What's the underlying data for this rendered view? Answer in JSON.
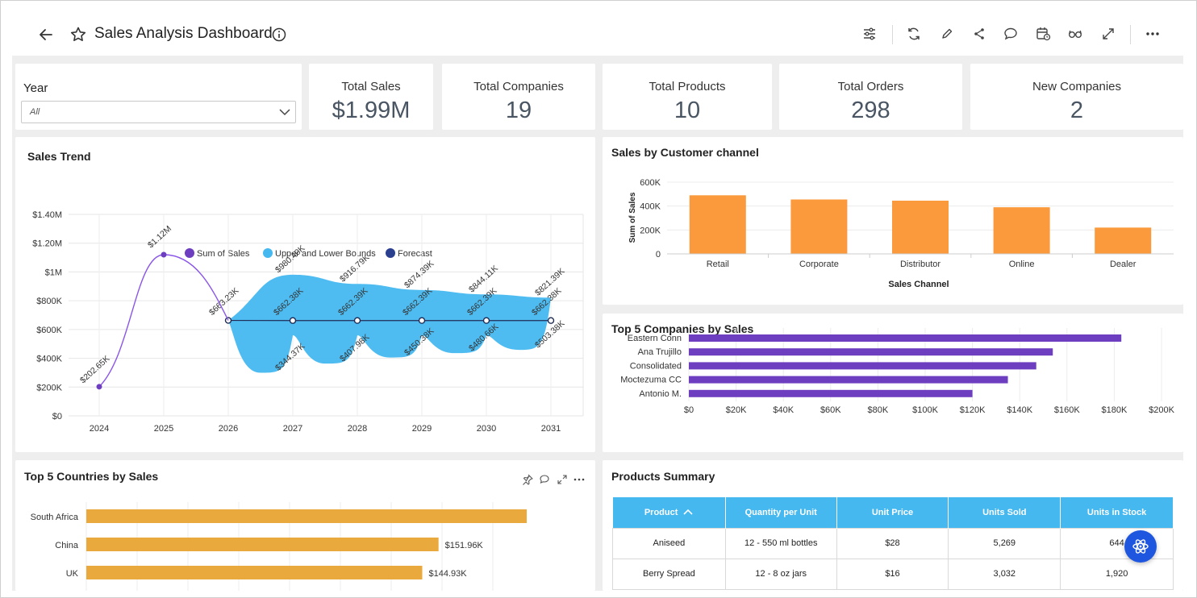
{
  "header": {
    "title": "Sales Analysis Dashboard",
    "toolbar_icons": [
      "filter-sliders-icon",
      "refresh-icon",
      "edit-pencil-icon",
      "share-icon",
      "comment-icon",
      "calendar-clock-icon",
      "glasses-icon",
      "expand-icon",
      "more-icon"
    ]
  },
  "filter": {
    "label": "Year",
    "value": "All"
  },
  "kpis": [
    {
      "title": "Total Sales",
      "value": "$1.99M"
    },
    {
      "title": "Total Companies",
      "value": "19"
    },
    {
      "title": "Total Products",
      "value": "10"
    },
    {
      "title": "Total Orders",
      "value": "298"
    },
    {
      "title": "New Companies",
      "value": "2"
    }
  ],
  "colors": {
    "accent": "#45b8f0",
    "orange": "#fb9a3d",
    "purple": "#6d3fc0",
    "gold": "#e9a93d",
    "fab": "#1e56e0"
  },
  "charts": {
    "sales_trend": {
      "title": "Sales Trend"
    },
    "channel": {
      "title": "Sales by Customer channel"
    },
    "companies": {
      "title": "Top 5 Companies by Sales"
    },
    "countries": {
      "title": "Top 5 Countries by Sales"
    },
    "products": {
      "title": "Products Summary"
    }
  },
  "chart_data": [
    {
      "type": "line",
      "title": "Sales Trend",
      "legend": [
        "Sum of Sales",
        "Upper and Lower Bounds",
        "Forecast"
      ],
      "legend_placement": "top-center",
      "x": [
        "2024",
        "2025",
        "2026",
        "2027",
        "2028",
        "2029",
        "2030",
        "2031"
      ],
      "y_ticks": [
        "$0",
        "$200K",
        "$400K",
        "$600K",
        "$800K",
        "$1M",
        "$1.20M",
        "$1.40M"
      ],
      "ylim": [
        0,
        1400000
      ],
      "grid": true,
      "series": [
        {
          "name": "Sum of Sales",
          "x": [
            "2024",
            "2025",
            "2026"
          ],
          "values": [
            202650,
            1120000,
            663230
          ],
          "labels": [
            "$202.65K",
            "$1.12M",
            "$663.23K"
          ]
        },
        {
          "name": "Forecast",
          "x": [
            "2026",
            "2027",
            "2028",
            "2029",
            "2030",
            "2031"
          ],
          "values": [
            663230,
            662380,
            662390,
            662390,
            662390,
            662380
          ],
          "labels": [
            "$663.23K",
            "$662.38K",
            "$662.39K",
            "$662.39K",
            "$662.39K",
            "$662.38K"
          ]
        },
        {
          "name": "Upper Bound",
          "x": [
            "2026",
            "2027",
            "2028",
            "2029",
            "2030",
            "2031"
          ],
          "values": [
            663230,
            980400,
            916790,
            874390,
            844110,
            821390
          ],
          "labels": [
            "",
            "$980.40K",
            "$916.79K",
            "$874.39K",
            "$844.11K",
            "$821.39K"
          ]
        },
        {
          "name": "Lower Bound",
          "x": [
            "2026",
            "2027",
            "2028",
            "2029",
            "2030",
            "2031"
          ],
          "values": [
            663230,
            344370,
            407980,
            450380,
            480660,
            503380
          ],
          "labels": [
            "",
            "$344.37K",
            "$407.98K",
            "$450.38K",
            "$480.66K",
            "$503.38K"
          ]
        }
      ]
    },
    {
      "type": "bar",
      "title": "Sales by Customer channel",
      "categories": [
        "Retail",
        "Corporate",
        "Distributor",
        "Online",
        "Dealer"
      ],
      "values": [
        490000,
        455000,
        445000,
        390000,
        220000
      ],
      "xlabel": "Sales Channel",
      "ylabel": "Sum of Sales",
      "y_ticks": [
        "0",
        "200K",
        "400K",
        "600K"
      ],
      "ylim": [
        0,
        600000
      ],
      "grid": true
    },
    {
      "type": "bar",
      "orientation": "horizontal",
      "title": "Top 5 Companies by Sales",
      "categories": [
        "Eastern Conn",
        "Ana Trujillo",
        "Consolidated",
        "Moctezuma CC",
        "Antonio M."
      ],
      "values": [
        183000,
        154000,
        147000,
        135000,
        120000
      ],
      "x_ticks": [
        "$0",
        "$20K",
        "$40K",
        "$60K",
        "$80K",
        "$100K",
        "$120K",
        "$140K",
        "$160K",
        "$180K",
        "$200K"
      ],
      "xlim": [
        0,
        200000
      ],
      "grid": true
    },
    {
      "type": "bar",
      "orientation": "horizontal",
      "title": "Top 5 Countries by Sales",
      "categories": [
        "South Africa",
        "China",
        "UK"
      ],
      "values": [
        190000,
        151960,
        144930
      ],
      "labels": [
        "",
        "$151.96K",
        "$144.93K"
      ],
      "grid": true
    },
    {
      "type": "table",
      "title": "Products Summary",
      "columns": [
        "Product",
        "Quantity per Unit",
        "Unit Price",
        "Units Sold",
        "Units in Stock"
      ],
      "rows": [
        [
          "Aniseed",
          "12 - 550 ml bottles",
          "$28",
          "5,269",
          "644"
        ],
        [
          "Berry Spread",
          "12 - 8 oz jars",
          "$16",
          "3,032",
          "1,920"
        ]
      ]
    }
  ]
}
